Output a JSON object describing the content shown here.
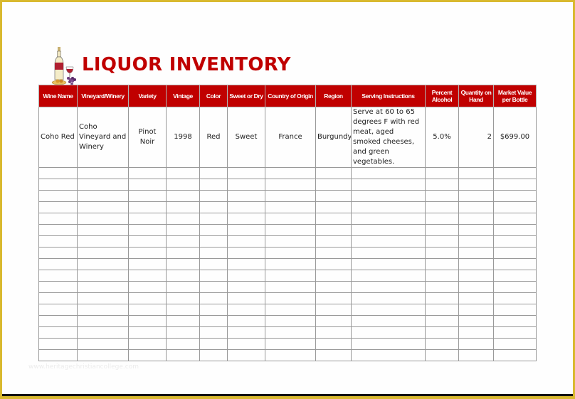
{
  "document": {
    "title": "LIQUOR INVENTORY",
    "logo_icon": "wine-bottle-glass-grapes-icon",
    "watermark": "www.heritagechristiancollege.com"
  },
  "colors": {
    "accent": "#c00000",
    "frame": "#d9b92f",
    "grid": "#999999"
  },
  "table": {
    "headers": [
      "Wine Name",
      "Vineyard/Winery",
      "Variety",
      "Vintage",
      "Color",
      "Sweet or Dry",
      "Country of Origin",
      "Region",
      "Serving Instructions",
      "Percent Alcohol",
      "Quantity on Hand",
      "Market Value per Bottle"
    ],
    "rows": [
      {
        "wine_name": "Coho Red",
        "vineyard": "Coho Vineyard and Winery",
        "variety": "Pinot Noir",
        "vintage": "1998",
        "color": "Red",
        "sweet_or_dry": "Sweet",
        "country": "France",
        "region": "Burgundy",
        "serving": "Serve at 60 to 65 degrees F with red meat, aged smoked cheeses, and green vegetables.",
        "percent_alcohol": "5.0%",
        "quantity": "2",
        "market_value": "$699.00"
      }
    ],
    "empty_row_count": 17
  }
}
